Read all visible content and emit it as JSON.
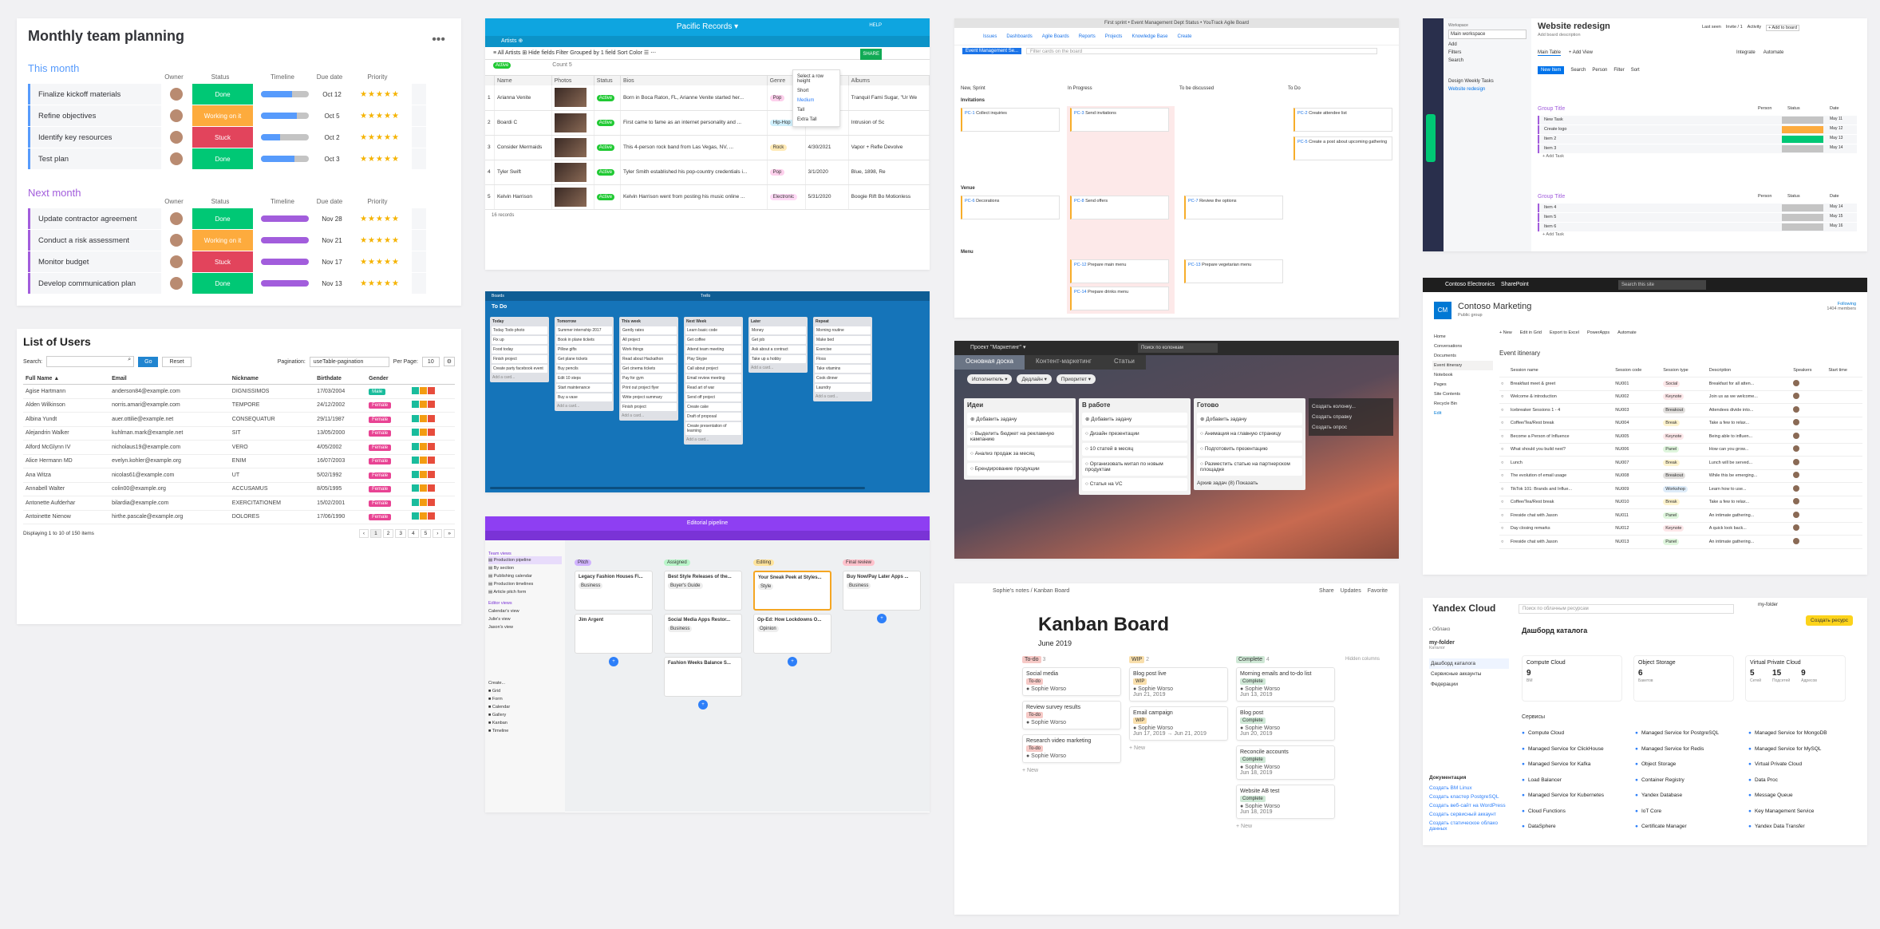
{
  "monday": {
    "title": "Monthly team planning",
    "menu": "•••",
    "groups": [
      {
        "name": "This month",
        "color": "#579bfc",
        "headers": [
          "Owner",
          "Status",
          "Timeline",
          "Due date",
          "Priority"
        ],
        "rows": [
          {
            "name": "Finalize kickoff materials",
            "status": "Done",
            "status_color": "#00c875",
            "due": "Oct 12",
            "progress": 0.65,
            "tl": "#579bfc"
          },
          {
            "name": "Refine objectives",
            "status": "Working on it",
            "status_color": "#fdab3d",
            "due": "Oct 5",
            "progress": 0.75,
            "tl": "#579bfc"
          },
          {
            "name": "Identify key resources",
            "status": "Stuck",
            "status_color": "#e2445c",
            "due": "Oct 2",
            "progress": 0.4,
            "tl": "#579bfc"
          },
          {
            "name": "Test plan",
            "status": "Done",
            "status_color": "#00c875",
            "due": "Oct 3",
            "progress": 0.7,
            "tl": "#579bfc"
          }
        ]
      },
      {
        "name": "Next month",
        "color": "#a25ddc",
        "headers": [
          "Owner",
          "Status",
          "Timeline",
          "Due date",
          "Priority"
        ],
        "rows": [
          {
            "name": "Update contractor agreement",
            "status": "Done",
            "status_color": "#00c875",
            "due": "Nov 28",
            "progress": 1,
            "tl": "#a25ddc"
          },
          {
            "name": "Conduct a risk assessment",
            "status": "Working on it",
            "status_color": "#fdab3d",
            "due": "Nov 21",
            "progress": 1,
            "tl": "#a25ddc"
          },
          {
            "name": "Monitor budget",
            "status": "Stuck",
            "status_color": "#e2445c",
            "due": "Nov 17",
            "progress": 1,
            "tl": "#a25ddc"
          },
          {
            "name": "Develop communication plan",
            "status": "Done",
            "status_color": "#00c875",
            "due": "Nov 13",
            "progress": 1,
            "tl": "#a25ddc"
          }
        ]
      }
    ],
    "stars": "★★★★★"
  },
  "users": {
    "title": "List of Users",
    "search_label": "Search:",
    "go": "Go",
    "reset": "Reset",
    "pagination_label": "Pagination:",
    "pagination_value": "useTable-pagination",
    "per_page_label": "Per Page:",
    "per_page": "10",
    "columns": [
      "Full Name ▲",
      "Email",
      "Nickname",
      "Birthdate",
      "Gender"
    ],
    "rows": [
      [
        "Agise Hartmann",
        "anderson84@example.com",
        "DIGNISSIMOS",
        "17/03/2004",
        "Male"
      ],
      [
        "Alden Wilkinson",
        "norris.amari@example.com",
        "TEMPORE",
        "24/12/2002",
        "Female"
      ],
      [
        "Albina Yundt",
        "auer.ottilie@example.net",
        "CONSEQUATUR",
        "29/11/1987",
        "Female"
      ],
      [
        "Alejandrin Walker",
        "kuhlman.mark@example.net",
        "SIT",
        "13/05/2000",
        "Female"
      ],
      [
        "Alford McGlynn IV",
        "nicholaus19@example.com",
        "VERO",
        "4/05/2002",
        "Female"
      ],
      [
        "Alice Hermann MD",
        "evelyn.kohler@example.org",
        "ENIM",
        "16/07/2003",
        "Female"
      ],
      [
        "Ana Witza",
        "nicolas61@example.com",
        "UT",
        "5/02/1992",
        "Female"
      ],
      [
        "Annabell Walter",
        "colin00@example.org",
        "ACCUSAMUS",
        "8/05/1995",
        "Female"
      ],
      [
        "Antonette Aufderhar",
        "bilardia@example.com",
        "EXERCITATIONEM",
        "15/02/2001",
        "Female"
      ],
      [
        "Antoinette Nienow",
        "hirthe.pascale@example.org",
        "DOLORES",
        "17/06/1990",
        "Female"
      ]
    ],
    "footer": "Displaying 1 to 10 of 150 items",
    "pages": [
      "‹",
      "1",
      "2",
      "3",
      "4",
      "5",
      "›",
      "»"
    ]
  },
  "airtable": {
    "title": "Pacific Records ▾",
    "help": "HELP",
    "tabs": "Artists  ⊕",
    "share": "SHARE",
    "blocks": "BLOCKS",
    "toolbar": "≡  All Artists ⊞    Hide fields   Filter   Grouped by 1 field   Sort   Color   ☰   ⋯",
    "status_group": "Active",
    "count": "Count 5",
    "columns": [
      "",
      "Name",
      "Photos",
      "Status",
      "Bios",
      "Genre",
      "Contract End",
      "Albums"
    ],
    "rows": [
      [
        "1",
        "Arianna Venite",
        "Active",
        "Born in Boca Raton, FL, Arianne Venite started her...",
        "Pop",
        "",
        "Tranquil Fami Sugar, \"Ur We"
      ],
      [
        "2",
        "Boardi C",
        "Active",
        "First came to fame as an internet personality and ...",
        "Hip-Hop",
        "10/12/2019",
        "Intrusion of Sc"
      ],
      [
        "3",
        "Consider Mermaids",
        "Active",
        "This 4-person rock band from Las Vegas, NV, ...",
        "Rock",
        "4/30/2021",
        "Vapor + Refle Devolve"
      ],
      [
        "4",
        "Tyler Swift",
        "Active",
        "Tyler Smith established his pop-country credentials i...",
        "Pop",
        "3/1/2020",
        "Blue, 1898, Re"
      ],
      [
        "5",
        "Kelvin Harrison",
        "Active",
        "Kelvin Harrison went from posting his music online ...",
        "Electronic",
        "5/31/2020",
        "Boogie Rift Bo Motionless"
      ]
    ],
    "records": "16 records",
    "dropdown": [
      "Select a row height",
      "Short",
      "Medium",
      "Tall",
      "Extra Tall"
    ]
  },
  "youtrack": {
    "title": "First sprint • Event Management Dept Status • YouTrack Agile Board",
    "nav": [
      "Issues",
      "Dashboards",
      "Agile Boards",
      "Reports",
      "Projects",
      "Knowledge Base",
      "Create"
    ],
    "board": "Event Management Se...",
    "filter": "Filter cards on the board",
    "columns": [
      "New, Sprint",
      "In Progress",
      "To be discussed",
      "To Do"
    ],
    "cards": [
      {
        "id": "PC-1",
        "text": "Collect inquiries"
      },
      {
        "id": "PC-3",
        "text": "Send invitations"
      },
      {
        "id": "PC-2",
        "text": "Create attendee list"
      },
      {
        "id": "PC-5",
        "text": "Create a post about upcoming gathering"
      },
      {
        "id": "PC-6",
        "text": "Decorations"
      },
      {
        "id": "PC-8",
        "text": "Send offers"
      },
      {
        "id": "PC-7",
        "text": "Review the options"
      },
      {
        "id": "PC-12",
        "text": "Prepare main menu"
      },
      {
        "id": "PC-13",
        "text": "Prepare vegetarian menu"
      },
      {
        "id": "PC-14",
        "text": "Prepare drinks menu"
      }
    ],
    "swimlanes": [
      "Invitations",
      "Venue",
      "Menu"
    ]
  },
  "monday2": {
    "workspace": "Main workspace",
    "title": "Website redesign",
    "desc": "Add board description",
    "view": "Main Table",
    "add_view": "+ Add View",
    "new_item": "New Item",
    "search": "Search",
    "person": "Person",
    "filter": "Filter",
    "sort": "Sort",
    "groups": [
      {
        "name": "Group Title",
        "color": "#a25ddc",
        "items": [
          "New Task",
          "Create logo",
          "Item 2",
          "Item 3"
        ],
        "add": "+ Add Task"
      },
      {
        "name": "Group Title",
        "color": "#a25ddc",
        "items": [
          "Item 4",
          "Item 5",
          "Item 6"
        ],
        "add": "+ Add Task"
      }
    ],
    "cols": [
      "Person",
      "Status",
      "Date"
    ],
    "dates": [
      "May 11",
      "May 12",
      "May 13",
      "May 14",
      "May 15",
      "May 16"
    ],
    "sidebar": [
      "Add",
      "Filters",
      "Search",
      "Design Weekly Tasks",
      "Website redesign"
    ],
    "last_seen": "Last seen",
    "invite": "Invite / 1",
    "activity": "Activity",
    "add_board": "+ Add to board",
    "integrate": "Integrate",
    "automate": "Automate"
  },
  "sharepoint": {
    "org": "Contoso Electronics",
    "app": "SharePoint",
    "search": "Search this site",
    "site": "Contoso Marketing",
    "group": "Public group",
    "following": "Following",
    "members": "1404 members",
    "nav": [
      "Home",
      "Conversations",
      "Documents",
      "Event itinerary",
      "Notebook",
      "Pages",
      "Site Contents",
      "Recycle Bin",
      "Edit"
    ],
    "cmd": [
      "+ New",
      "Edit in Grid",
      "Export to Excel",
      "PowerApps",
      "Automate"
    ],
    "list_title": "Event itinerary",
    "columns": [
      "Session name",
      "Session code",
      "Session type",
      "Description",
      "Speakers",
      "Start time"
    ],
    "rows": [
      [
        "Breakfast meet & greet",
        "NU001",
        "Social",
        "Breakfast for all atten..."
      ],
      [
        "Welcome & introduction",
        "NU002",
        "Keynote",
        "Join us as we welcome..."
      ],
      [
        "Icebreaker Sessions 1 - 4",
        "NU003",
        "Breakout",
        "Attendees divide into..."
      ],
      [
        "Coffee/Tea/Rest break",
        "NU004",
        "Break",
        "Take a few to relax..."
      ],
      [
        "Become a Person of Influence",
        "NU005",
        "Keynote",
        "Being able to influen..."
      ],
      [
        "What should you build next?",
        "NU006",
        "Panel",
        "How can you grow..."
      ],
      [
        "Lunch",
        "NU007",
        "Break",
        "Lunch will be served..."
      ],
      [
        "The evolution of email usage",
        "NU008",
        "Breakout",
        "While this be emerging..."
      ],
      [
        "TikTok 101: Brands and Influe...",
        "NU009",
        "Workshop",
        "Learn how to use..."
      ],
      [
        "Coffee/Tea/Rest break",
        "NU010",
        "Break",
        "Take a few to relax..."
      ],
      [
        "Fireside chat with Jason",
        "NU011",
        "Panel",
        "An intimate gathering..."
      ],
      [
        "Day closing remarks",
        "NU012",
        "Keynote",
        "A quick look back..."
      ],
      [
        "Fireside chat with Jason",
        "NU013",
        "Panel",
        "An intimate gathering..."
      ]
    ]
  },
  "trello": {
    "board": "Boards",
    "logo": "Trello",
    "title": "To Do",
    "lists": [
      {
        "name": "Today",
        "cards": [
          "Today Todo photo",
          "Fix up",
          "Food today",
          "Finish project",
          "Create party facebook event"
        ]
      },
      {
        "name": "Tomorrow",
        "cards": [
          "Summer internship 2017",
          "Book in plane tickets",
          "Pillow gifts",
          "Get plane tickets",
          "Buy pencils",
          "Edit 10 steps",
          "Start maintenance",
          "Buy a vase"
        ]
      },
      {
        "name": "This week",
        "cards": [
          "Gently rates",
          "All project",
          "Work things",
          "Read about Hackathon",
          "Get cinema tickets",
          "Pay for gym",
          "Print out project flyer",
          "Write project summary",
          "Finish project"
        ]
      },
      {
        "name": "Next Week",
        "cards": [
          "Learn basic code",
          "Get coffee",
          "Attend team meeting",
          "Play Skype",
          "Call about project",
          "Email review meeting",
          "Read art of war",
          "Send off project",
          "Create cake",
          "Draft of proposal",
          "Create presentation of learning"
        ]
      },
      {
        "name": "Later",
        "cards": [
          "Money",
          "Get job",
          "Ask about a contract",
          "Take up a hobby"
        ]
      },
      {
        "name": "Repeat",
        "cards": [
          "Morning routine",
          "Make bed",
          "Exercise",
          "Floss",
          "Take vitamins",
          "Cook dinner",
          "Laundry"
        ]
      }
    ]
  },
  "darkboard": {
    "project": "Проект \"Маркетинг\" ▾",
    "search": "Поиск по колонкам",
    "tabs": [
      "Основная доска",
      "Контент-маркетинг",
      "Статьи"
    ],
    "filters": [
      "Исполнитель",
      "Дедлайн",
      "Приоритет"
    ],
    "columns": [
      {
        "name": "Идеи",
        "add": "Добавить задачу",
        "items": [
          "Выделить бюджет на рекламную кампанию",
          "Анализ продаж за месяц",
          "Брендирование продукции"
        ]
      },
      {
        "name": "В работе",
        "add": "Добавить задачу",
        "items": [
          "Дизайн презентации",
          "10 статей в месяц",
          "Организовать митап по новым продуктам",
          "Статья на VC"
        ]
      },
      {
        "name": "Готово",
        "add": "Добавить задачу",
        "items": [
          "Анимация на главную страницу",
          "Подготовить презентацию",
          "Разместить статью на партнерском площадке"
        ]
      }
    ],
    "archive": "Архив задач (8)",
    "show": "Показать",
    "side": [
      "Создать колонку...",
      "Создать справку",
      "Создать опрос"
    ]
  },
  "purple": {
    "title": "Editorial pipeline",
    "nav": [
      "Production pipeline",
      "By section",
      "Publishing calendar",
      "Production timelines",
      "Article pitch form"
    ],
    "views": [
      "Team views",
      "Editor views",
      "Calendar's view",
      "Julie's view",
      "Jason's view"
    ],
    "create": "Create...",
    "types": [
      "Grid",
      "Form",
      "Calendar",
      "Gallery",
      "Kanban",
      "Timeline"
    ],
    "columns": [
      {
        "name": "Pitch",
        "color": "#d0b3ff",
        "cards": [
          "Legacy Fashion Houses Fi...",
          "Business",
          "Jim Argent"
        ]
      },
      {
        "name": "Assigned",
        "color": "#b9f5c9",
        "cards": [
          "Best Style Releases of the...",
          "Buyer's Guide",
          "Social Media Apps Restor...",
          "Business",
          "Fashion Weeks Balance S..."
        ]
      },
      {
        "name": "Editing",
        "color": "#ffe39b",
        "cards": [
          "Your Sneak Peek at Styles...",
          "Style",
          "Op-Ed: How Lockdowns O...",
          "Opinion"
        ]
      },
      {
        "name": "Final review",
        "color": "#ffc2cc",
        "cards": [
          "Buy Now/Pay Later Apps ...",
          "Business"
        ]
      }
    ]
  },
  "notion": {
    "crumbs": "Sophie's notes  /  Kanban Board",
    "share": "Share",
    "updates": "Updates",
    "favorite": "Favorite",
    "title": "Kanban Board",
    "subtitle": "June 2019",
    "columns": [
      {
        "name": "To-do",
        "count": "3",
        "color": "#f6c9c6",
        "cards": [
          {
            "t": "Social media",
            "tag": "To-do",
            "who": "Sophie Worso"
          },
          {
            "t": "Review survey results",
            "tag": "To-do",
            "who": "Sophie Worso"
          },
          {
            "t": "Research video marketing",
            "tag": "To-do",
            "who": "Sophie Worso"
          }
        ]
      },
      {
        "name": "WIP",
        "count": "2",
        "color": "#f9dfac",
        "cards": [
          {
            "t": "Blog post live",
            "tag": "WIP",
            "who": "Sophie Worso",
            "date": "Jun 21, 2019"
          },
          {
            "t": "Email campaign",
            "tag": "WIP",
            "who": "Sophie Worso",
            "date": "Jun 17, 2019 → Jun 21, 2019"
          }
        ]
      },
      {
        "name": "Complete",
        "count": "4",
        "color": "#cfe8d6",
        "cards": [
          {
            "t": "Morning emails and to-do list",
            "tag": "Complete",
            "who": "Sophie Worso",
            "date": "Jun 13, 2019"
          },
          {
            "t": "Blog post",
            "tag": "Complete",
            "who": "Sophie Worso",
            "date": "Jun 20, 2019"
          },
          {
            "t": "Reconcile accounts",
            "tag": "Complete",
            "who": "Sophie Worso",
            "date": "Jun 18, 2019"
          },
          {
            "t": "Website AB test",
            "tag": "Complete",
            "who": "Sophie Worso",
            "date": "Jun 18, 2019"
          }
        ]
      }
    ],
    "new": "+ New",
    "hidden": "Hidden columns"
  },
  "yandex": {
    "logo": "Yandex Cloud",
    "search": "Поиск по облачным ресурсам",
    "folder": "my-folder",
    "create": "Создать ресурс",
    "back": "Облако",
    "catalog": "Каталог",
    "side": [
      "Дашборд каталога",
      "Сервисные аккаунты",
      "Федерации"
    ],
    "title": "Дашборд каталога",
    "boxes": [
      {
        "name": "Compute Cloud",
        "vals": [
          "9"
        ],
        "sub": [
          "ВМ"
        ]
      },
      {
        "name": "Object Storage",
        "vals": [
          "6"
        ],
        "sub": [
          "Бакетов"
        ]
      },
      {
        "name": "Virtual Private Cloud",
        "vals": [
          "5",
          "15",
          "9"
        ],
        "sub": [
          "Сетей",
          "Подсетей",
          "Адресов"
        ]
      }
    ],
    "services_title": "Сервисы",
    "services": [
      [
        "Compute Cloud",
        "Managed Service for PostgreSQL",
        "Managed Service for MongoDB"
      ],
      [
        "Managed Service for ClickHouse",
        "Managed Service for Redis",
        "Managed Service for MySQL"
      ],
      [
        "Managed Service for Kafka",
        "Object Storage",
        "Virtual Private Cloud"
      ],
      [
        "Load Balancer",
        "Container Registry",
        "Data Proc"
      ],
      [
        "Managed Service for Kubernetes",
        "Yandex Database",
        "Message Queue"
      ],
      [
        "Cloud Functions",
        "IoT Core",
        "Key Management Service"
      ],
      [
        "DataSphere",
        "Certificate Manager",
        "Yandex Data Transfer"
      ]
    ],
    "docs_title": "Документация",
    "docs": [
      "Создать ВМ Linux",
      "Создать кластер PostgreSQL",
      "Создать веб-сайт на WordPress",
      "Создать сервисный аккаунт",
      "Создать статическое облако данных"
    ]
  }
}
